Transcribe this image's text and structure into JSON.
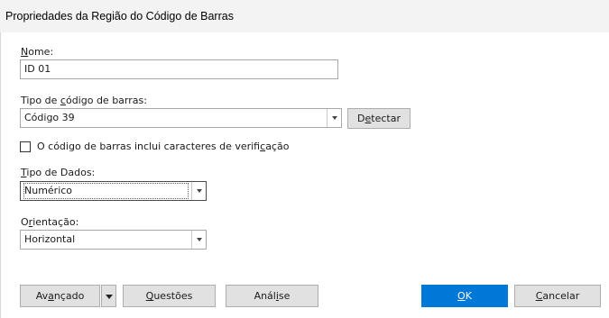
{
  "window": {
    "title": "Propriedades da Região do Código de Barras"
  },
  "name_field": {
    "label_access_key": "N",
    "label_rest": "ome:",
    "value": "ID 01"
  },
  "barcode_type": {
    "label_pre": "Tipo de ",
    "label_access_key": "c",
    "label_post": "ódigo de barras:",
    "selected": "Código 39",
    "detect_pre": "D",
    "detect_access_key": "e",
    "detect_post": "tectar"
  },
  "check_chars": {
    "label_pre": "O código de barras inclui caracteres de verifi",
    "label_access_key": "c",
    "label_post": "ação",
    "checked": false
  },
  "data_type": {
    "label_access_key": "T",
    "label_rest": "ipo de Dados:",
    "selected": "Numérico"
  },
  "orientation": {
    "label_pre": "O",
    "label_access_key": "r",
    "label_post": "ientação:",
    "selected": "Horizontal"
  },
  "footer": {
    "advanced_pre": "Av",
    "advanced_access_key": "a",
    "advanced_post": "nçado",
    "questions_access_key": "Q",
    "questions_rest": "uestões",
    "analyze_pre": "Anál",
    "analyze_access_key": "i",
    "analyze_post": "se",
    "ok_access_key": "O",
    "ok_rest": "K",
    "cancel_access_key": "C",
    "cancel_rest": "ancelar"
  },
  "colors": {
    "primary_button": "#0078d7",
    "title_bar": "#f3f3f3"
  }
}
